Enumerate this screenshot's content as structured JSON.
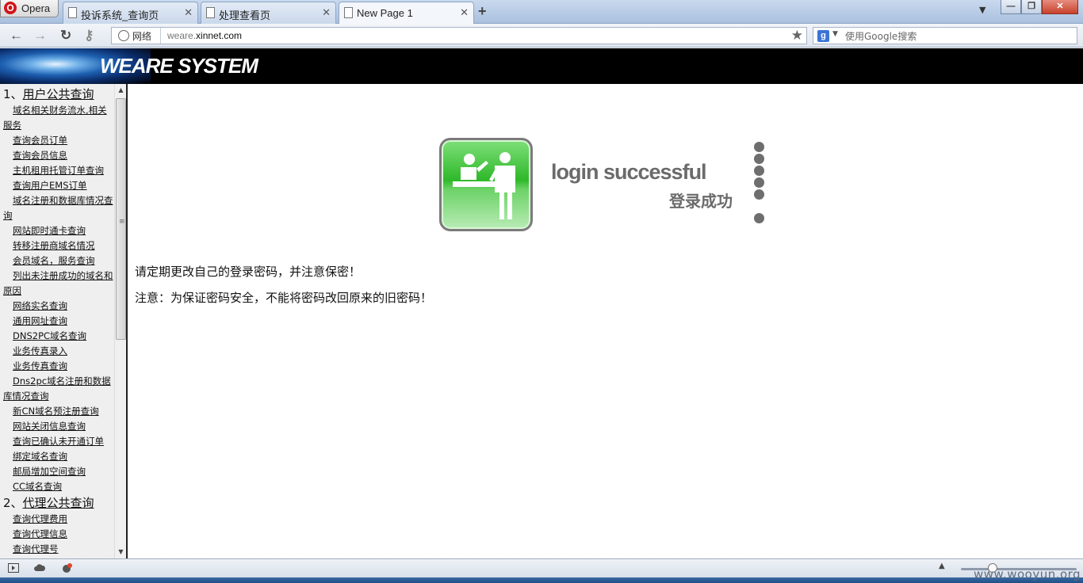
{
  "browser": {
    "menu_label": "Opera",
    "tabs": [
      {
        "label": "投诉系统_查询页"
      },
      {
        "label": "处理查看页"
      },
      {
        "label": "New Page 1"
      }
    ],
    "address": {
      "security_label": "网络",
      "url_prefix": "weare.",
      "url_domain": "xinnet.com"
    },
    "search": {
      "placeholder": "使用Google搜索"
    }
  },
  "header": {
    "title": "WEARE SYSTEM"
  },
  "sidebar": {
    "section1_number": "1、",
    "section1_title": "用户公共查询",
    "section1_items": [
      "域名相关财务流水,相关服务",
      "查询会员订单",
      "查询会员信息",
      "主机租用托管订单查询",
      "查询用户EMS订单",
      "域名注册和数据库情况查询",
      "网站即时通卡查询",
      "转移注册商域名情况",
      "会员域名，服务查询",
      "列出未注册成功的域名和原因",
      "网络实名查询",
      "通用网址查询",
      "DNS2PC域名查询",
      "业务传真录入",
      "业务传真查询",
      "Dns2pc域名注册和数据库情况查询",
      "新CN域名预注册查询",
      "网站关闭信息查询",
      "查询已确认未开通订单",
      "绑定域名查询",
      "邮局增加空间查询",
      "CC域名查询"
    ],
    "section2_number": "2、",
    "section2_title": "代理公共查询",
    "section2_items": [
      "查询代理费用",
      "查询代理信息",
      "查询代理号"
    ]
  },
  "main": {
    "success_en": "login successful",
    "success_cn": "登录成功",
    "notice1": "请定期更改自己的登录密码，并注意保密！",
    "notice2": "注意：为保证密码安全，不能将密码改回原来的旧密码！"
  },
  "watermark": "www.wooyun.org",
  "colors": {
    "icon_green": "#2fb82a",
    "header_bg": "#000000",
    "success_text": "#6b6b6b"
  }
}
